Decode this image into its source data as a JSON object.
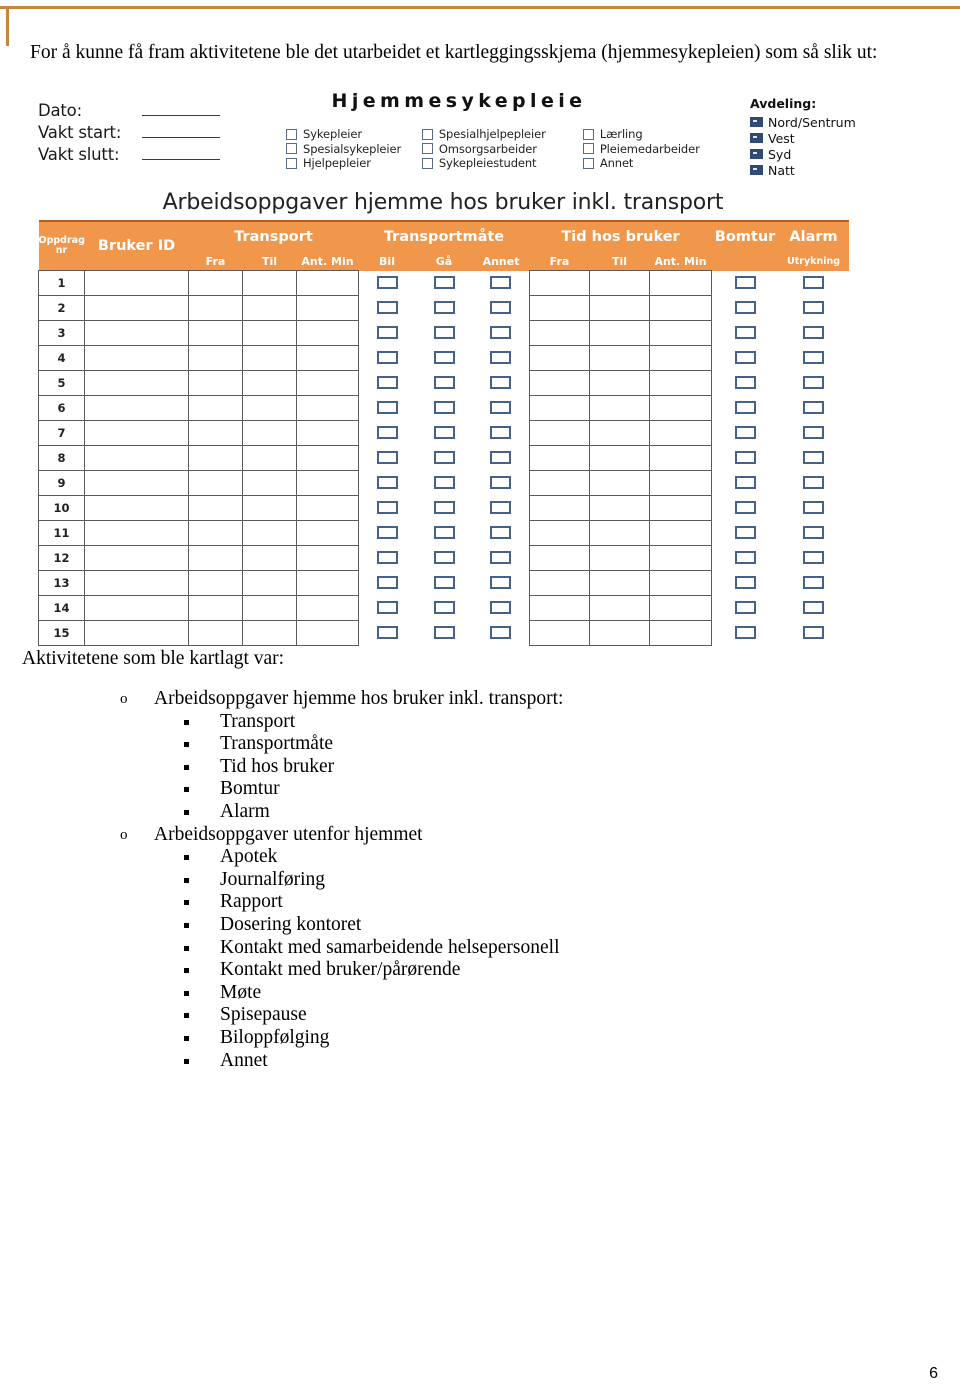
{
  "intro": {
    "text": "For å kunne få fram aktivitetene ble det utarbeidet et kartleggingsskjema (hjemmesykepleien) som så slik ut:"
  },
  "form": {
    "title": "Hjemmesykepleie",
    "date_fields": [
      {
        "label": "Dato:"
      },
      {
        "label": "Vakt start:"
      },
      {
        "label": "Vakt slutt:"
      }
    ],
    "role_columns": [
      {
        "items": [
          "Sykepleier",
          "Spesialsykepleier",
          "Hjelpepleier"
        ]
      },
      {
        "items": [
          "Spesialhjelpepleier",
          "Omsorgsarbeider",
          "Sykepleiestudent"
        ]
      },
      {
        "items": [
          "Lærling",
          "Pleiemedarbeider",
          "Annet"
        ]
      }
    ],
    "avdeling": {
      "title": "Avdeling:",
      "items": [
        "Nord/Sentrum",
        "Vest",
        "Syd",
        "Natt"
      ]
    },
    "table": {
      "title": "Arbeidsoppgaver hjemme hos bruker inkl. transport",
      "header_main": [
        "Oppdrag nr",
        "Bruker ID",
        "Transport",
        "Transportmåte",
        "Tid hos bruker",
        "Bomtur",
        "Alarm"
      ],
      "header_sub": {
        "transport": [
          "Fra",
          "Til",
          "Ant. Min"
        ],
        "transportmate": [
          "Bil",
          "Gå",
          "Annet"
        ],
        "tid_hos_bruker": [
          "Fra",
          "Til",
          "Ant. Min"
        ],
        "bomtur": "",
        "alarm": "Utrykning"
      },
      "row_numbers": [
        "1",
        "2",
        "3",
        "4",
        "5",
        "6",
        "7",
        "8",
        "9",
        "10",
        "11",
        "12",
        "13",
        "14",
        "15"
      ],
      "header_bg": "#f0974c",
      "header_text_color": "#ffffff",
      "checkbox_border": "#46618c"
    }
  },
  "prose": {
    "lead": "Aktivitetene som ble kartlagt var:",
    "groups": [
      {
        "bullet": "o",
        "title": "Arbeidsoppgaver hjemme hos bruker inkl. transport:",
        "items": [
          "Transport",
          "Transportmåte",
          "Tid hos bruker",
          "Bomtur",
          "Alarm"
        ]
      },
      {
        "bullet": "o",
        "title": "Arbeidsoppgaver utenfor hjemmet",
        "items": [
          "Apotek",
          "Journalføring",
          "Rapport",
          "Dosering kontoret",
          "Kontakt med samarbeidende helsepersonell",
          "Kontakt med bruker/pårørende",
          "Møte",
          "Spisepause",
          "Biloppfølging",
          "Annet"
        ]
      }
    ]
  },
  "page_number": "6"
}
